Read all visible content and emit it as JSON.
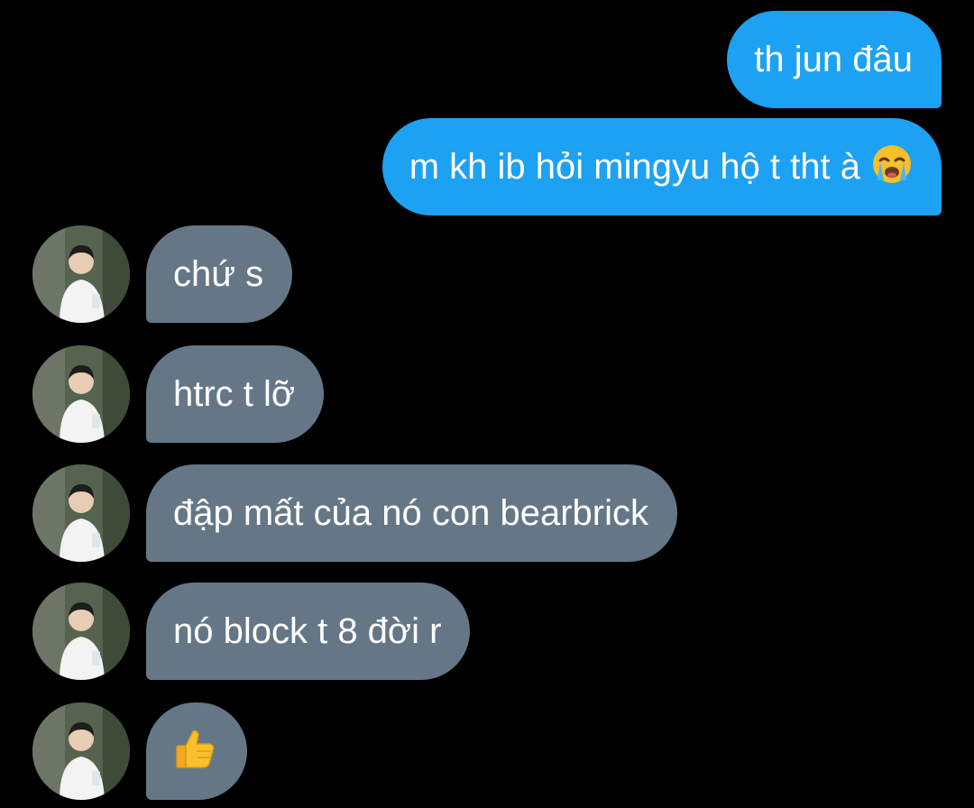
{
  "conversation": {
    "sent_messages": [
      {
        "text": "th jun đâu",
        "emoji": ""
      },
      {
        "text": "m kh ib hỏi mingyu hộ t tht à",
        "emoji": "loudly-crying-face-icon"
      }
    ],
    "received_messages": [
      {
        "text": "chứ s"
      },
      {
        "text": "htrc t lỡ"
      },
      {
        "text": "đập mất của nó con bearbrick"
      },
      {
        "text": "nó block t 8 đời r"
      },
      {
        "text": "",
        "emoji": "thumbs-up-icon"
      }
    ]
  },
  "colors": {
    "background": "#000000",
    "sent_bubble": "#1da1f2",
    "received_bubble": "#657786",
    "text": "#ffffff"
  },
  "icons": {
    "avatar": "profile-photo-avatar"
  }
}
